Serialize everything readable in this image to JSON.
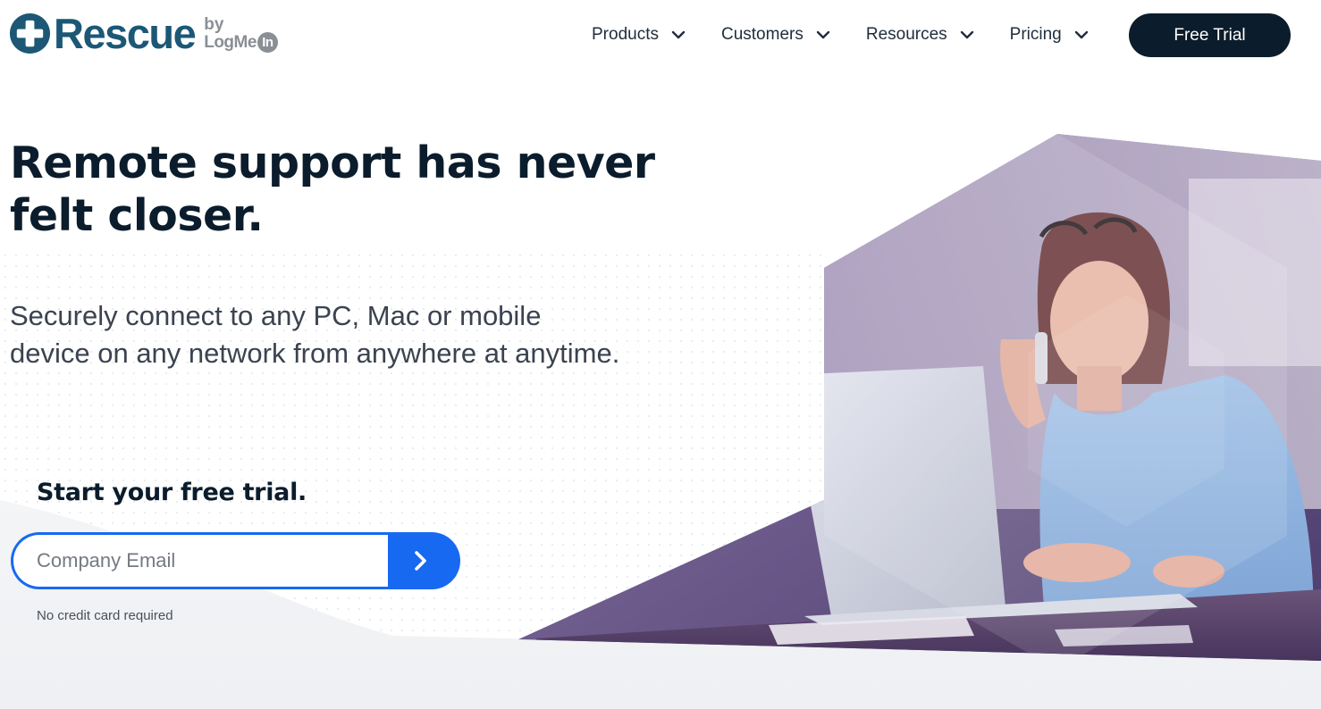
{
  "brand": {
    "name": "Rescue",
    "by": "by",
    "parent": "LogMe",
    "parent_badge": "In",
    "color": "#1c5876"
  },
  "nav": {
    "items": [
      {
        "label": "Products",
        "icon": "chevron-down-icon"
      },
      {
        "label": "Customers",
        "icon": "chevron-down-icon"
      },
      {
        "label": "Resources",
        "icon": "chevron-down-icon"
      },
      {
        "label": "Pricing",
        "icon": "chevron-down-icon"
      }
    ],
    "cta_label": "Free Trial",
    "cta_color": "#0b1c2c"
  },
  "hero": {
    "headline": "Remote support has never felt closer.",
    "subhead": "Securely connect to any PC, Mac or mobile device on any network from anywhere at anytime.",
    "trial_heading": "Start your free trial.",
    "email_placeholder": "Company Email",
    "submit_icon": "chevron-right-icon",
    "accent_color": "#1769f2",
    "disclaimer": "No credit card required"
  }
}
